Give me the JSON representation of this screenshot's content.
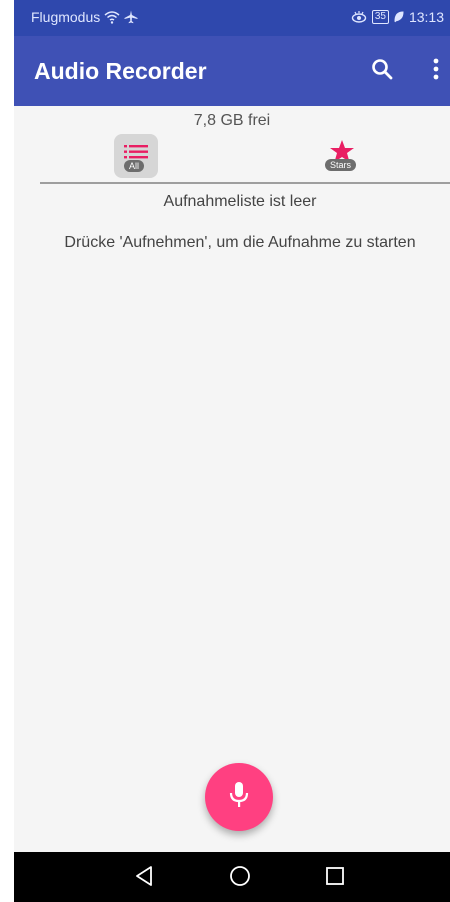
{
  "status_bar": {
    "carrier_label": "Flugmodus",
    "battery_level": "35",
    "time": "13:13"
  },
  "app_bar": {
    "title": "Audio Recorder",
    "icons": [
      "search-icon",
      "overflow-menu-icon"
    ]
  },
  "storage": {
    "free_text": "7,8 GB frei"
  },
  "tabs": [
    {
      "label": "All",
      "icon": "list-icon",
      "selected": true
    },
    {
      "label": "Stars",
      "icon": "star-icon",
      "selected": false
    }
  ],
  "empty_state": {
    "title": "Aufnahmeliste ist leer",
    "hint": "Drücke 'Aufnehmen', um die Aufnahme zu starten"
  },
  "fab": {
    "icon": "microphone-icon"
  },
  "colors": {
    "status_bar": "#2f48ad",
    "app_bar": "#3f51b5",
    "accent": "#ff4081",
    "background": "#f5f5f5"
  }
}
